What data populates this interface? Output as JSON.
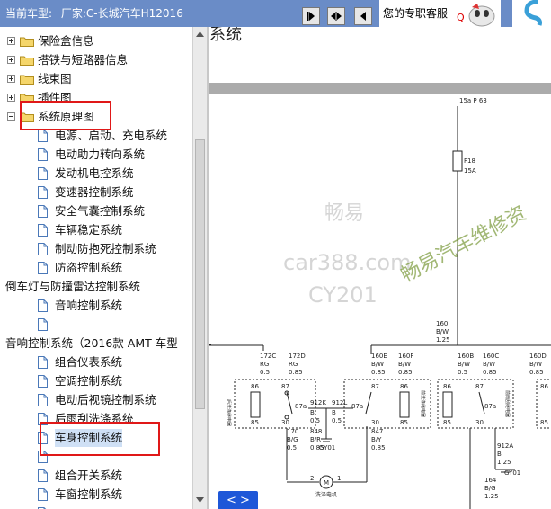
{
  "topbar": {
    "current_car_label": "当前车型:",
    "maker_label": "厂家:C-长城汽车H12016",
    "support_text": "您的专职客服",
    "support_link": "Q"
  },
  "tree": {
    "items": [
      {
        "label": "保险盒信息",
        "type": "folder"
      },
      {
        "label": "搭铁与短路器信息",
        "type": "folder"
      },
      {
        "label": "线束图",
        "type": "folder"
      },
      {
        "label": "插件图",
        "type": "folder"
      },
      {
        "label": "系统原理图",
        "type": "folder-open"
      },
      {
        "label": "电源、启动、充电系统",
        "type": "doc"
      },
      {
        "label": "电动助力转向系统",
        "type": "doc"
      },
      {
        "label": "发动机电控系统",
        "type": "doc"
      },
      {
        "label": "变速器控制系统",
        "type": "doc"
      },
      {
        "label": "安全气囊控制系统",
        "type": "doc"
      },
      {
        "label": "车辆稳定系统",
        "type": "doc"
      },
      {
        "label": "制动防抱死控制系统",
        "type": "doc"
      },
      {
        "label": "防盗控制系统",
        "type": "doc"
      },
      {
        "label": "倒车灯与防撞雷达控制系统",
        "type": "text"
      },
      {
        "label": "音响控制系统",
        "type": "doc"
      },
      {
        "label": "",
        "type": "doc"
      },
      {
        "label": "音响控制系统（2016款 AMT 车型",
        "type": "text"
      },
      {
        "label": "组合仪表系统",
        "type": "doc"
      },
      {
        "label": "空调控制系统",
        "type": "doc"
      },
      {
        "label": "电动后视镜控制系统",
        "type": "doc"
      },
      {
        "label": "后雨刮洗涤系统",
        "type": "doc"
      },
      {
        "label": "车身控制系统",
        "type": "doc-selected"
      },
      {
        "label": "",
        "type": "doc"
      },
      {
        "label": "组合开关系统",
        "type": "doc"
      },
      {
        "label": "车窗控制系统",
        "type": "doc"
      },
      {
        "label": "",
        "type": "doc"
      }
    ]
  },
  "main": {
    "title": "刂系统",
    "page_nav": "< >"
  },
  "diagram": {
    "fuse_top": "15a P 63",
    "fuse_name": "F18",
    "fuse_rating": "15A",
    "bus_wire": [
      "160",
      "B/W",
      "1.25"
    ],
    "watermark_lines": [
      "畅易",
      "car388.com",
      "CY201",
      "畅易汽车维修资"
    ],
    "wire_labels": [
      [
        "172C",
        "RG",
        "0.5"
      ],
      [
        "172D",
        "RG",
        "0.85"
      ],
      [
        "160E",
        "B/W",
        "0.85"
      ],
      [
        "160F",
        "B/W",
        "0.85"
      ],
      [
        "160B",
        "B/W",
        "0.5"
      ],
      [
        "160C",
        "B/W",
        "0.85"
      ],
      [
        "160D",
        "B/W",
        "0.85"
      ],
      [
        "912K",
        "B",
        "0.5"
      ],
      [
        "912L",
        "B",
        "0.5"
      ],
      [
        "170",
        "B/G",
        "0.5"
      ],
      [
        "848",
        "B/R",
        "0.85"
      ],
      [
        "847",
        "B/Y",
        "0.85"
      ],
      [
        "912A",
        "B",
        "1.25"
      ],
      [
        "164",
        "B/G",
        "1.25"
      ]
    ],
    "relay_labels": [
      "后洗涤继电器",
      "前洗涤继电器",
      "前雨刮继电器"
    ],
    "pins": [
      "86",
      "87",
      "87a",
      "85",
      "30"
    ],
    "ground": "GY01",
    "motor_label": "洗涤电机",
    "motor_pins": [
      "2",
      "1"
    ]
  }
}
